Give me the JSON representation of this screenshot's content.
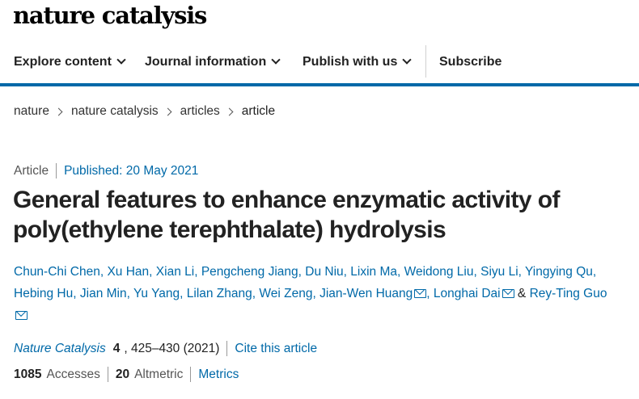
{
  "site": {
    "logo": "nature catalysis"
  },
  "nav": {
    "items": [
      {
        "label": "Explore content"
      },
      {
        "label": "Journal information"
      },
      {
        "label": "Publish with us"
      }
    ],
    "subscribe": "Subscribe"
  },
  "breadcrumb": [
    "nature",
    "nature catalysis",
    "articles",
    "article"
  ],
  "article": {
    "type": "Article",
    "published": "Published: 20 May 2021",
    "title_lines": [
      "General features to enhance enzymatic activity of",
      "poly(ethylene terephthalate) hydrolysis"
    ],
    "authors": [
      "Chun-Chi Chen",
      "Xu Han",
      "Xian Li",
      "Pengcheng Jiang",
      "Du Niu",
      "Lixin Ma",
      "Weidong Liu",
      "Siyu Li",
      "Yingying Qu",
      "Hebing Hu",
      "Jian Min",
      "Yu Yang",
      "Lilan Zhang",
      "Wei Zeng",
      "Jian-Wen Huang",
      "Longhai Dai",
      "Rey-Ting Guo"
    ],
    "author_separator": ", ",
    "author_amp": "&",
    "citation": {
      "journal": "Nature Catalysis",
      "volume": "4",
      "pages": ", 425–430 (2021)",
      "cite_link": "Cite this article"
    },
    "metrics": {
      "accesses_count": "1085",
      "accesses_label": "Accesses",
      "altmetric_count": "20",
      "altmetric_label": "Altmetric",
      "metrics_link": "Metrics"
    }
  },
  "colors": {
    "link": "#0069a8",
    "nav_bar": "#0069a8",
    "text": "#222222"
  },
  "icons": {
    "mail": "envelope-icon",
    "nav_chevron": "chevron-down-icon",
    "crumb_sep": "chevron-right-icon"
  }
}
